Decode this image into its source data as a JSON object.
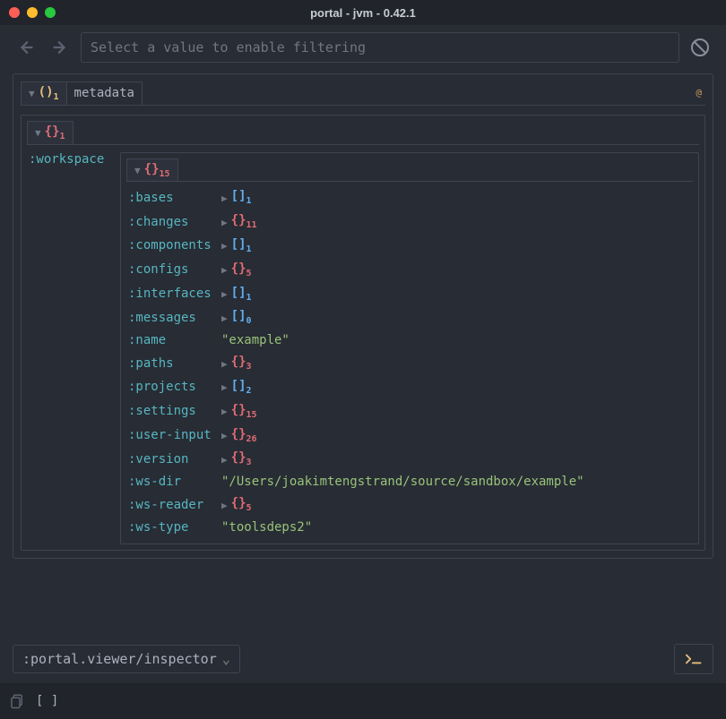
{
  "window": {
    "title": "portal - jvm - 0.42.1"
  },
  "search": {
    "placeholder": "Select a value to enable filtering"
  },
  "breadcrumb": {
    "root": {
      "open": "(",
      "close": ")",
      "count": 1
    },
    "meta": "metadata"
  },
  "inner": {
    "header": {
      "open": "{",
      "close": "}",
      "count": 1
    },
    "key": ":workspace"
  },
  "workspace": {
    "header": {
      "open": "{",
      "close": "}",
      "count": 15
    },
    "entries": [
      {
        "key": ":bases",
        "type": "vec",
        "open": "[",
        "close": "]",
        "count": 1
      },
      {
        "key": ":changes",
        "type": "map",
        "open": "{",
        "close": "}",
        "count": 11
      },
      {
        "key": ":components",
        "type": "vec",
        "open": "[",
        "close": "]",
        "count": 1
      },
      {
        "key": ":configs",
        "type": "map",
        "open": "{",
        "close": "}",
        "count": 5
      },
      {
        "key": ":interfaces",
        "type": "vec",
        "open": "[",
        "close": "]",
        "count": 1
      },
      {
        "key": ":messages",
        "type": "vec",
        "open": "[",
        "close": "]",
        "count": 0
      },
      {
        "key": ":name",
        "type": "str",
        "value": "\"example\""
      },
      {
        "key": ":paths",
        "type": "map",
        "open": "{",
        "close": "}",
        "count": 3
      },
      {
        "key": ":projects",
        "type": "vec",
        "open": "[",
        "close": "]",
        "count": 2
      },
      {
        "key": ":settings",
        "type": "map",
        "open": "{",
        "close": "}",
        "count": 15
      },
      {
        "key": ":user-input",
        "type": "map",
        "open": "{",
        "close": "}",
        "count": 26
      },
      {
        "key": ":version",
        "type": "map",
        "open": "{",
        "close": "}",
        "count": 3
      },
      {
        "key": ":ws-dir",
        "type": "str",
        "value": "\"/Users/joakimtengstrand/source/sandbox/example\""
      },
      {
        "key": ":ws-reader",
        "type": "map",
        "open": "{",
        "close": "}",
        "count": 5
      },
      {
        "key": ":ws-type",
        "type": "str",
        "value": "\"toolsdeps2\""
      }
    ]
  },
  "viewer": {
    "selected": ":portal.viewer/inspector"
  },
  "bottom": {
    "vec": "[ ]"
  }
}
